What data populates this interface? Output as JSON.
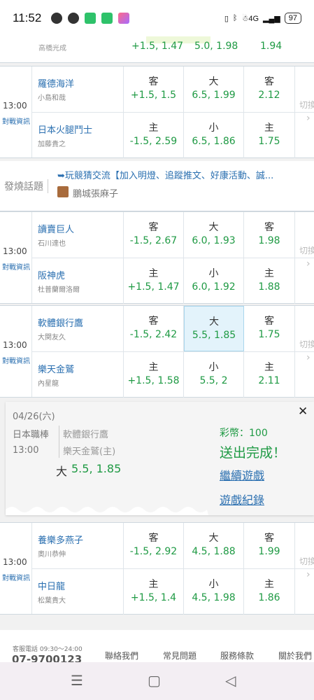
{
  "status_bar": {
    "time": "11:52",
    "network": "☃4G",
    "battery": "97"
  },
  "partial_game": {
    "pitcher": "高橋光成",
    "odd1": "+1.5, 1.47",
    "odd2": "5.0, 1.98",
    "odd3": "1.94"
  },
  "games": [
    {
      "time": "13:00",
      "info_link": "對戰資訊",
      "switch": "切換",
      "away": {
        "team": "羅德海洋",
        "pitcher": "小島和哉",
        "spread_label": "客",
        "spread": "+1.5, 1.5",
        "total_label": "大",
        "total": "6.5, 1.99",
        "ml_label": "客",
        "ml": "2.12"
      },
      "home": {
        "team": "日本火腿鬥士",
        "pitcher": "加藤貴之",
        "spread_label": "主",
        "spread": "-1.5, 2.59",
        "total_label": "小",
        "total": "6.5, 1.86",
        "ml_label": "主",
        "ml": "1.75"
      }
    },
    {
      "time": "13:00",
      "info_link": "對戰資訊",
      "switch": "切換",
      "away": {
        "team": "讀賣巨人",
        "pitcher": "石川達也",
        "spread_label": "客",
        "spread": "-1.5, 2.67",
        "total_label": "大",
        "total": "6.0, 1.93",
        "ml_label": "客",
        "ml": "1.98"
      },
      "home": {
        "team": "阪神虎",
        "pitcher": "杜普蘭爾洛爾",
        "spread_label": "主",
        "spread": "+1.5, 1.47",
        "total_label": "小",
        "total": "6.0, 1.92",
        "ml_label": "主",
        "ml": "1.88"
      }
    },
    {
      "time": "13:00",
      "info_link": "對戰資訊",
      "switch": "切換",
      "away": {
        "team": "軟體銀行鷹",
        "pitcher": "大関友久",
        "spread_label": "客",
        "spread": "-1.5, 2.42",
        "total_label": "大",
        "total": "5.5, 1.85",
        "ml_label": "客",
        "ml": "1.75"
      },
      "home": {
        "team": "樂天金鷲",
        "pitcher": "內星龍",
        "spread_label": "主",
        "spread": "+1.5, 1.58",
        "total_label": "小",
        "total": "5.5, 2",
        "ml_label": "主",
        "ml": "2.11"
      }
    },
    {
      "time": "13:00",
      "info_link": "對戰資訊",
      "switch": "切換",
      "away": {
        "team": "養樂多燕子",
        "pitcher": "奧川恭伸",
        "spread_label": "客",
        "spread": "-1.5, 2.92",
        "total_label": "大",
        "total": "4.5, 1.88",
        "ml_label": "客",
        "ml": "1.99"
      },
      "home": {
        "team": "中日龍",
        "pitcher": "松葉貴大",
        "spread_label": "主",
        "spread": "+1.5, 1.4",
        "total_label": "小",
        "total": "4.5, 1.98",
        "ml_label": "主",
        "ml": "1.86"
      }
    }
  ],
  "topic": {
    "label": "發燒話題",
    "title": "➥玩競猜交流【加入明燈、追蹤推文、好康活動、誠...",
    "author": "鵬城張麻子"
  },
  "popup": {
    "date": "04/26(六)",
    "league": "日本職棒",
    "time": "13:00",
    "team1": "軟體銀行鷹",
    "team2": "樂天金鷲(主)",
    "bet_label": "大",
    "bet_value": "5.5, 1.85",
    "coins": "彩幣：100",
    "done": "送出完成！",
    "continue": "繼續遊戲",
    "record": "遊戲紀錄",
    "close": "✕"
  },
  "footer": {
    "phone_label": "客服電話 09:30～24:00",
    "phone": "07-9700123",
    "links": [
      "聯絡我們",
      "常見問題",
      "服務條款",
      "關於我們"
    ]
  },
  "nav": {
    "menu": "☰",
    "home": "▢",
    "back": "◁"
  }
}
